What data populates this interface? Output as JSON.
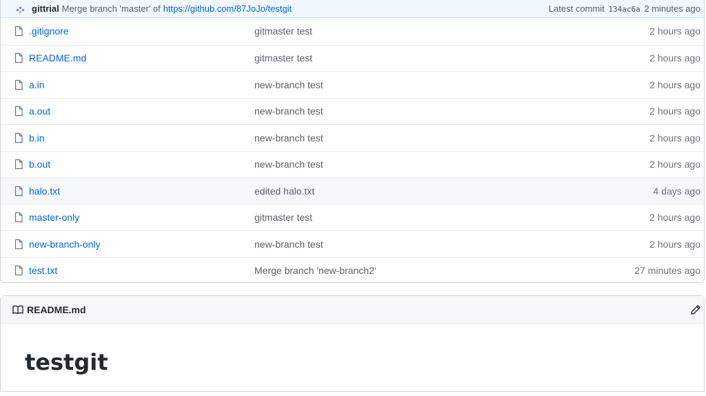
{
  "commit": {
    "author": "gittrial",
    "message": "Merge branch 'master' of",
    "link": "https://github.com/87JoJo/testgit",
    "latest_label": "Latest commit",
    "sha": "134ac6a",
    "age": "2 minutes ago"
  },
  "files": [
    {
      "name": ".gitignore",
      "message": "gitmaster test",
      "age": "2 hours ago"
    },
    {
      "name": "README.md",
      "message": "gitmaster test",
      "age": "2 hours ago"
    },
    {
      "name": "a.in",
      "message": "new-branch test",
      "age": "2 hours ago"
    },
    {
      "name": "a.out",
      "message": "new-branch test",
      "age": "2 hours ago"
    },
    {
      "name": "b.in",
      "message": "new-branch test",
      "age": "2 hours ago"
    },
    {
      "name": "b.out",
      "message": "new-branch test",
      "age": "2 hours ago"
    },
    {
      "name": "halo.txt",
      "message": "edited halo.txt",
      "age": "4 days ago"
    },
    {
      "name": "master-only",
      "message": "gitmaster test",
      "age": "2 hours ago"
    },
    {
      "name": "new-branch-only",
      "message": "new-branch test",
      "age": "2 hours ago"
    },
    {
      "name": "test.txt",
      "message": "Merge branch 'new-branch2'",
      "age": "27 minutes ago"
    }
  ],
  "readme": {
    "filename": "README.md",
    "title": "testgit"
  },
  "icons": {
    "file": "file-icon",
    "book": "book-icon",
    "edit": "pencil-icon",
    "avatar": "avatar-icon"
  },
  "colors": {
    "link": "#0366d6",
    "commit_bar_bg": "#f1f8ff",
    "hover_row_bg": "#f6f8fa"
  }
}
